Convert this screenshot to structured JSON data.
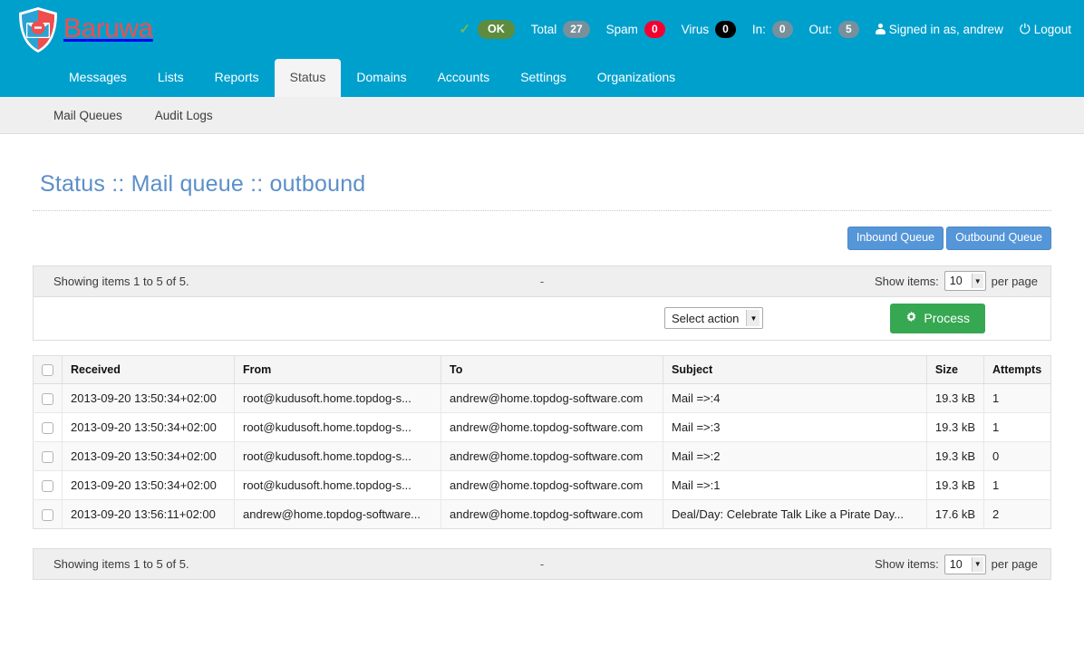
{
  "brand": {
    "name": "Baruwa",
    "logo_icon": "shield-envelope-icon"
  },
  "statusbar": {
    "check_icon": "checkmark-icon",
    "ok_label": "OK",
    "total_label": "Total",
    "total_value": "27",
    "spam_label": "Spam",
    "spam_value": "0",
    "virus_label": "Virus",
    "virus_value": "0",
    "in_label": "In:",
    "in_value": "0",
    "out_label": "Out:",
    "out_value": "5",
    "user_icon": "user-icon",
    "signed_in_text": "Signed in as, andrew",
    "power_icon": "power-icon",
    "logout_label": "Logout"
  },
  "mainnav": {
    "items": [
      {
        "label": "Messages",
        "active": false
      },
      {
        "label": "Lists",
        "active": false
      },
      {
        "label": "Reports",
        "active": false
      },
      {
        "label": "Status",
        "active": true
      },
      {
        "label": "Domains",
        "active": false
      },
      {
        "label": "Accounts",
        "active": false
      },
      {
        "label": "Settings",
        "active": false
      },
      {
        "label": "Organizations",
        "active": false
      }
    ]
  },
  "subnav": {
    "items": [
      {
        "label": "Mail Queues"
      },
      {
        "label": "Audit Logs"
      }
    ]
  },
  "page": {
    "title": "Status :: Mail queue :: outbound"
  },
  "queue_buttons": {
    "inbound_label": "Inbound Queue",
    "outbound_label": "Outbound Queue"
  },
  "infobar_top": {
    "showing_text": "Showing items 1 to 5 of 5.",
    "middle_text": "-",
    "show_items_label": "Show items:",
    "per_page_value": "10",
    "per_page_label": "per page",
    "dropdown_icon": "chevron-down-icon"
  },
  "actionbar": {
    "select_action_value": "Select action",
    "select_dropdown_icon": "chevron-down-icon",
    "process_icon": "gear-icon",
    "process_label": "Process"
  },
  "table": {
    "headers": {
      "select_all": "",
      "received": "Received",
      "from": "From",
      "to": "To",
      "subject": "Subject",
      "size": "Size",
      "attempts": "Attempts"
    },
    "rows": [
      {
        "received": "2013-09-20 13:50:34+02:00",
        "from": "root@kudusoft.home.topdog-s...",
        "to": "andrew@home.topdog-software.com",
        "subject": "Mail =>:4",
        "size": "19.3 kB",
        "attempts": "1"
      },
      {
        "received": "2013-09-20 13:50:34+02:00",
        "from": "root@kudusoft.home.topdog-s...",
        "to": "andrew@home.topdog-software.com",
        "subject": "Mail =>:3",
        "size": "19.3 kB",
        "attempts": "1"
      },
      {
        "received": "2013-09-20 13:50:34+02:00",
        "from": "root@kudusoft.home.topdog-s...",
        "to": "andrew@home.topdog-software.com",
        "subject": "Mail =>:2",
        "size": "19.3 kB",
        "attempts": "0"
      },
      {
        "received": "2013-09-20 13:50:34+02:00",
        "from": "root@kudusoft.home.topdog-s...",
        "to": "andrew@home.topdog-software.com",
        "subject": "Mail =>:1",
        "size": "19.3 kB",
        "attempts": "1"
      },
      {
        "received": "2013-09-20 13:56:11+02:00",
        "from": "andrew@home.topdog-software...",
        "to": "andrew@home.topdog-software.com",
        "subject": "Deal/Day: Celebrate Talk Like a Pirate Day...",
        "size": "17.6 kB",
        "attempts": "2"
      }
    ]
  },
  "infobar_bottom": {
    "showing_text": "Showing items 1 to 5 of 5.",
    "middle_text": "-",
    "show_items_label": "Show items:",
    "per_page_value": "10",
    "per_page_label": "per page",
    "dropdown_icon": "chevron-down-icon"
  },
  "colors": {
    "brand_cyan": "#00a0cd",
    "brand_red": "#ef4e4e",
    "title_blue": "#5b8fc9",
    "button_blue": "#5596d8",
    "process_green": "#36a852",
    "ok_green": "#5d8c3f",
    "spam_red": "#f40030",
    "virus_black": "#000000",
    "badge_grey": "#78909c"
  }
}
